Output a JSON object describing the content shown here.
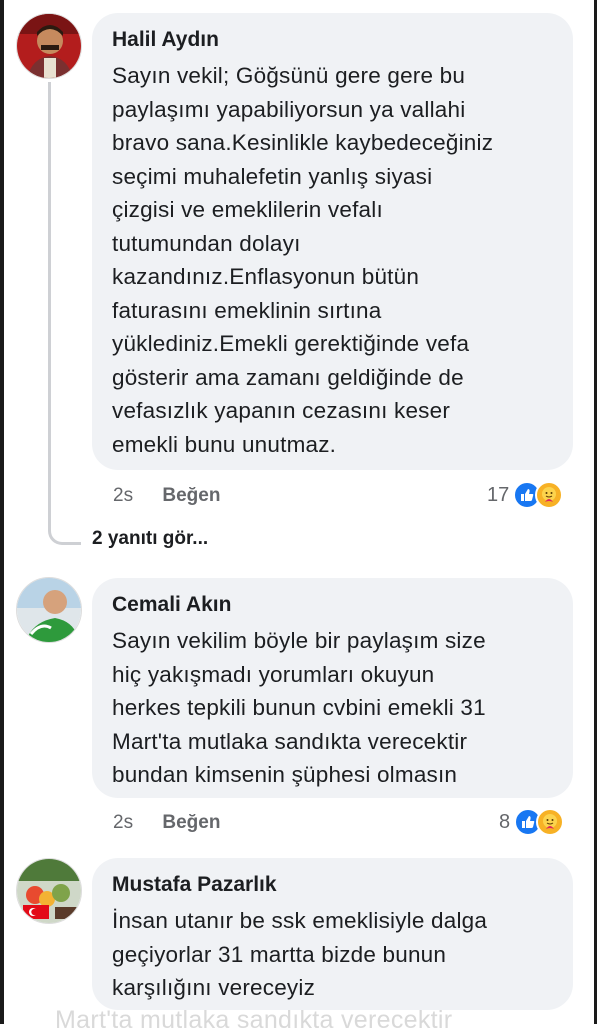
{
  "comments": [
    {
      "author": "Halil Aydın",
      "text": "Sayın vekil; Göğsünü gere gere bu\npaylaşımı yapabiliyorsun ya vallahi\nbravo sana.Kesinlikle kaybedeceğiniz\nseçimi muhalefetin yanlış siyasi\nçizgisi ve emeklilerin vefalı\ntutumundan dolayı\nkazandınız.Enflasyonun bütün\nfaturasını emeklinin sırtına\nyüklediniz.Emekli gerektiğinde vefa\ngösterir ama zamanı geldiğinde de\nvefasızlık yapanın cezasını keser\nemekli bunu unutmaz.",
      "time": "2s",
      "like_label": "Beğen",
      "reaction_count": "17",
      "view_replies": "2 yanıtı gör..."
    },
    {
      "author": "Cemali Akın",
      "text": "Sayın vekilim böyle bir paylaşım size\nhiç yakışmadı yorumları okuyun\nherkes tepkili bunun cvbini emekli 31\nMart'ta mutlaka sandıkta verecektir\nbundan kimsenin şüphesi olmasın",
      "time": "2s",
      "like_label": "Beğen",
      "reaction_count": "8"
    },
    {
      "author": "Mustafa Pazarlık",
      "text": "İnsan utanır be ssk emeklisiyle dalga\ngeçiyorlar 31 martta bizde bunun\nkarşılığını vereceyiz"
    }
  ],
  "partial_bottom_text": "Mart'ta mutlaka sandıkta verecektir",
  "colors": {
    "bubble": "#f0f2f5",
    "like_blue": "#1877f2",
    "care_yellow": "#f7b125",
    "meta_gray": "#65676b"
  },
  "icons": [
    "like-reaction-icon",
    "care-reaction-icon"
  ]
}
